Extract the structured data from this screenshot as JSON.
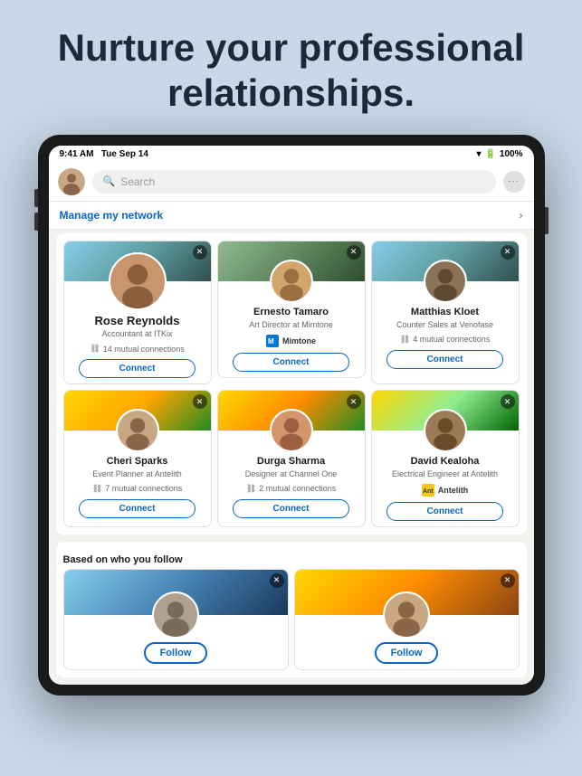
{
  "hero": {
    "title": "Nurture your professional relationships."
  },
  "statusBar": {
    "time": "9:41 AM",
    "date": "Tue Sep 14",
    "wifi": "WiFi",
    "battery": "100%"
  },
  "navbar": {
    "searchPlaceholder": "Search",
    "menuLabel": "···"
  },
  "manageNetwork": {
    "label": "Manage my network",
    "chevron": "›"
  },
  "people": [
    {
      "name": "Rose Reynolds",
      "title": "Accountant at ITKix",
      "connections": "14 mutual connections",
      "action": "Connect",
      "banner": "mountains",
      "large": true
    },
    {
      "name": "Ernesto Tamaro",
      "title": "Art Director at Mimtone",
      "company": "Mimtone",
      "action": "Connect",
      "banner": "forest"
    },
    {
      "name": "Matthias Kloet",
      "title": "Counter Sales at Venofase",
      "connections": "4 mutual connections",
      "action": "Connect",
      "banner": "mountains"
    },
    {
      "name": "Cheri Sparks",
      "title": "Event Planner at Antelith",
      "connections": "7 mutual connections",
      "action": "Connect",
      "banner": "yellow"
    },
    {
      "name": "Durga Sharma",
      "title": "Designer at Channel One",
      "connections": "2 mutual connections",
      "action": "Connect",
      "banner": "autumn"
    },
    {
      "name": "David Kealoha",
      "title": "Electrical Engineer at Antelith",
      "company": "Antelith",
      "action": "Connect",
      "banner": "tropical"
    }
  ],
  "basedOnFollow": {
    "sectionTitle": "Based on who you follow",
    "people": [
      {
        "action": "Follow",
        "banner": "forest"
      },
      {
        "action": "Follow",
        "banner": "autumn"
      }
    ]
  },
  "buttons": {
    "connect": "Connect",
    "follow": "Follow"
  }
}
